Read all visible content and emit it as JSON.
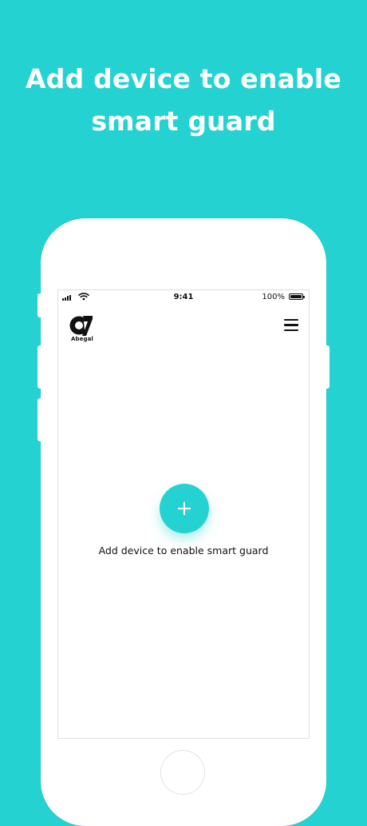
{
  "headline": "Add device to enable smart guard",
  "status_bar": {
    "time": "9:41",
    "battery_percent": "100%"
  },
  "app": {
    "logo_text": "Abegal",
    "empty_state_message": "Add device to enable smart guard"
  },
  "colors": {
    "background": "#25d2d2",
    "accent": "#25d2d2",
    "phone": "#ffffff"
  }
}
